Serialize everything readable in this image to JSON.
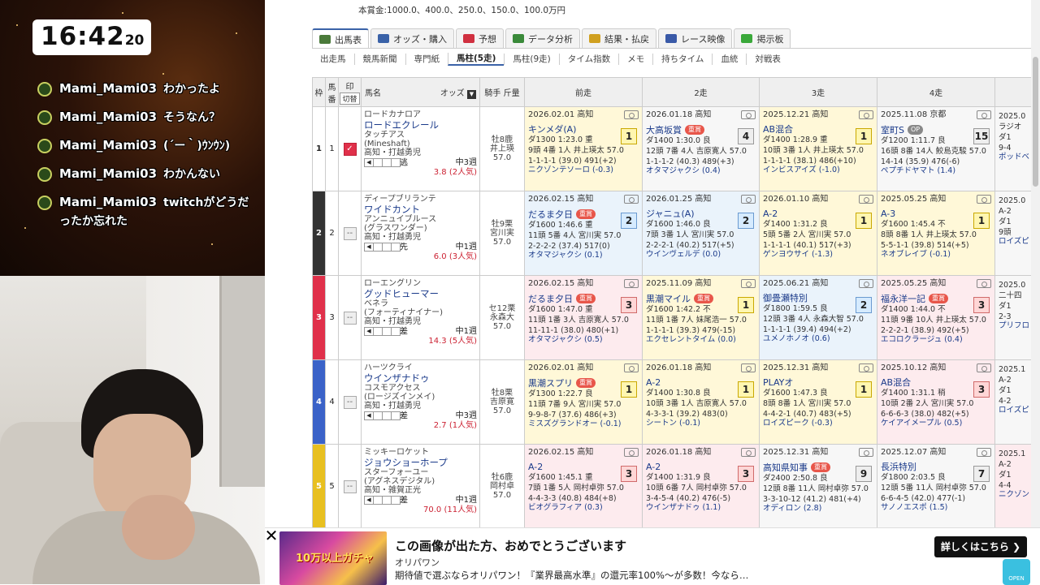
{
  "overlay": {
    "clock": {
      "hm": "16:42",
      "sec": "20"
    },
    "chat": [
      {
        "user": "Mami_Mami03",
        "text": "わかったよ"
      },
      {
        "user": "Mami_Mami03",
        "text": "そうなん？"
      },
      {
        "user": "Mami_Mami03",
        "text": "(´ー｀)ｳﾝｳﾝ)"
      },
      {
        "user": "Mami_Mami03",
        "text": "わかんない"
      },
      {
        "user": "Mami_Mami03",
        "text": "twitchがどうだったか忘れた"
      }
    ]
  },
  "prize_text": "本賞金:1000.0、400.0、250.0、150.0、100.0万円",
  "tabs": [
    {
      "label": "出馬表",
      "icon": "table-icon",
      "color": "#4a7a3a"
    },
    {
      "label": "オッズ・購入",
      "icon": "odds-icon",
      "color": "#3a62a8"
    },
    {
      "label": "予想",
      "icon": "target-icon",
      "color": "#d03040"
    },
    {
      "label": "データ分析",
      "icon": "chart-icon",
      "color": "#3a8a3a"
    },
    {
      "label": "結果・払戻",
      "icon": "coins-icon",
      "color": "#d0a020"
    },
    {
      "label": "レース映像",
      "icon": "video-icon",
      "color": "#3a5aa8"
    },
    {
      "label": "掲示板",
      "icon": "chat-icon",
      "color": "#3aa83a"
    }
  ],
  "subtabs": [
    "出走馬",
    "競馬新聞",
    "専門紙",
    "馬柱(5走)",
    "馬柱(9走)",
    "タイム指数",
    "メモ",
    "持ちタイム",
    "血統",
    "対戦表"
  ],
  "headers": {
    "waku": "枠",
    "umaban": "馬番",
    "mark": "印",
    "mark_btn": "切替",
    "name": "馬名",
    "odds": "オッズ",
    "jockey": "騎手 斤量",
    "r1": "前走",
    "r2": "2走",
    "r3": "3走",
    "r4": "4走"
  },
  "horses": [
    {
      "waku": "1",
      "no": "1",
      "waku_color": "#ffffff",
      "waku_text": "#222222",
      "checked": true,
      "sire": "ロードカナロア",
      "name": "ロードエクレール",
      "dam": "タッチアス",
      "damsire": "(Mineshaft)",
      "trainer": "高知・打越勇児",
      "style": "逃",
      "rest": "中3週",
      "odds": "3.8 (2人気)",
      "sex_age": "牡8鹿",
      "jockey": "井上瑛",
      "weight": "57.0",
      "races": [
        {
          "date": "2026.02.01 高知",
          "name": "キンメダ(A)",
          "grade": "",
          "pos": "1",
          "pc": "pw",
          "bg": "bg1",
          "l1": "ダ1300 1:23.0 重",
          "l2": "9頭 4番 1人 井上瑛太 57.0",
          "l3": "1-1-1-1 (39.0) 491(+2)",
          "op": "ニクゾンテソーロ (-0.3)"
        },
        {
          "date": "2026.01.18 高知",
          "name": "大高坂賞",
          "grade": "重賞",
          "pos": "4",
          "pc": "pg",
          "bg": "bg0",
          "l1": "ダ1400 1:30.0 良",
          "l2": "12頭 7番 4人 吉原寛人 57.0",
          "l3": "1-1-1-2 (40.3) 489(+3)",
          "op": "オタマジャクシ (0.4)"
        },
        {
          "date": "2025.12.21 高知",
          "name": "AB混合",
          "grade": "",
          "pos": "1",
          "pc": "pw",
          "bg": "bg1",
          "l1": "ダ1400 1:28.9 重",
          "l2": "10頭 3番 1人 井上瑛太 57.0",
          "l3": "1-1-1-1 (38.1) 486(+10)",
          "op": "インビスアイズ (-1.0)"
        },
        {
          "date": "2025.11.08 京都",
          "name": "室町S",
          "grade": "OP",
          "pos": "15",
          "pc": "pg",
          "bg": "bg0",
          "l1": "ダ1200 1:11.7 良",
          "l2": "16頭 8番 14人 鮫島克駿 57.0",
          "l3": "14-14 (35.9) 476(-6)",
          "op": "ペプチドヤマト (1.4)"
        }
      ]
    },
    {
      "waku": "2",
      "no": "2",
      "waku_color": "#333333",
      "waku_text": "#ffffff",
      "checked": false,
      "sire": "ディープブリランテ",
      "name": "ワイドカント",
      "dam": "アンニュイブルース",
      "damsire": "(グラスワンダー)",
      "trainer": "高知・打越勇児",
      "style": "先",
      "rest": "中1週",
      "odds": "6.0 (3人気)",
      "sex_age": "牡9栗",
      "jockey": "宮川実",
      "weight": "57.0",
      "races": [
        {
          "date": "2026.02.15 高知",
          "name": "だるま夕日",
          "grade": "重賞",
          "pos": "2",
          "pc": "pb",
          "bg": "bg2",
          "l1": "ダ1600 1:46.6 重",
          "l2": "11頭 5番 4人 宮川実 57.0",
          "l3": "2-2-2-2 (37.4) 517(0)",
          "op": "オタマジャクシ (0.1)"
        },
        {
          "date": "2026.01.25 高知",
          "name": "ジャニュ(A)",
          "grade": "",
          "pos": "2",
          "pc": "pb",
          "bg": "bg2",
          "l1": "ダ1600 1:46.0 良",
          "l2": "7頭 3番 1人 宮川実 57.0",
          "l3": "2-2-2-1 (40.2) 517(+5)",
          "op": "ウインヴェルデ (0.0)"
        },
        {
          "date": "2026.01.10 高知",
          "name": "A-2",
          "grade": "",
          "pos": "1",
          "pc": "pw",
          "bg": "bg1",
          "l1": "ダ1400 1:31.2 良",
          "l2": "5頭 5番 2人 宮川実 57.0",
          "l3": "1-1-1-1 (40.1) 517(+3)",
          "op": "ゲンヨウサイ (-1.3)"
        },
        {
          "date": "2025.05.25 高知",
          "name": "A-3",
          "grade": "",
          "pos": "1",
          "pc": "pw",
          "bg": "bg1",
          "l1": "ダ1600 1:45.4 不",
          "l2": "8頭 8番 1人 井上瑛太 57.0",
          "l3": "5-5-1-1 (39.8) 514(+5)",
          "op": "ネオブレイブ (-0.1)"
        }
      ]
    },
    {
      "waku": "3",
      "no": "3",
      "waku_color": "#e0304a",
      "waku_text": "#ffffff",
      "checked": false,
      "sire": "ローエングリン",
      "name": "グッドヒューマー",
      "dam": "ベネラ",
      "damsire": "(フォーティナイナー)",
      "trainer": "高知・打越勇児",
      "style": "差",
      "rest": "中1週",
      "odds": "14.3 (5人気)",
      "sex_age": "セ12栗",
      "jockey": "永森大",
      "weight": "57.0",
      "races": [
        {
          "date": "2026.02.15 高知",
          "name": "だるま夕日",
          "grade": "重賞",
          "pos": "3",
          "pc": "pr",
          "bg": "bg3",
          "l1": "ダ1600 1:47.0 重",
          "l2": "11頭 1番 3人 吉原寛人 57.0",
          "l3": "11-11-1 (38.0) 480(+1)",
          "op": "オタマジャクシ (0.5)"
        },
        {
          "date": "2025.11.09 高知",
          "name": "黒潮マイル",
          "grade": "重賞",
          "pos": "1",
          "pc": "pw",
          "bg": "bg1",
          "l1": "ダ1600 1:42.2 不",
          "l2": "11頭 1番 7人 妹尾浩一 57.0",
          "l3": "1-1-1-1 (39.3) 479(-15)",
          "op": "エクセレントタイム (0.0)"
        },
        {
          "date": "2025.06.21 高知",
          "name": "御畳瀬特別",
          "grade": "",
          "pos": "2",
          "pc": "pb",
          "bg": "bg2",
          "l1": "ダ1800 1:59.5 良",
          "l2": "12頭 3番 4人 永森大智 57.0",
          "l3": "1-1-1-1 (39.4) 494(+2)",
          "op": "ユメノホノオ (0.6)"
        },
        {
          "date": "2025.05.25 高知",
          "name": "福永洋一記",
          "grade": "重賞",
          "pos": "3",
          "pc": "pr",
          "bg": "bg3",
          "l1": "ダ1400 1:44.0 不",
          "l2": "11頭 9番 10人 井上瑛太 57.0",
          "l3": "2-2-2-1 (38.9) 492(+5)",
          "op": "エコロクラージュ (0.4)"
        }
      ]
    },
    {
      "waku": "4",
      "no": "4",
      "waku_color": "#3a62c8",
      "waku_text": "#ffffff",
      "checked": false,
      "sire": "ハーツクライ",
      "name": "ウインザナドゥ",
      "dam": "コスモアクセス",
      "damsire": "(ロージズインメイ)",
      "trainer": "高知・打越勇児",
      "style": "差",
      "rest": "中3週",
      "odds": "2.7 (1人気)",
      "sex_age": "牡8栗",
      "jockey": "吉原寛",
      "weight": "57.0",
      "races": [
        {
          "date": "2026.02.01 高知",
          "name": "黒潮スプリ",
          "grade": "重賞",
          "pos": "1",
          "pc": "pw",
          "bg": "bg1",
          "l1": "ダ1300 1:22.7 良",
          "l2": "11頭 7番 9人 宮川実 57.0",
          "l3": "9-9-8-7 (37.6) 486(+3)",
          "op": "ミスズグランドオー (-0.1)"
        },
        {
          "date": "2026.01.18 高知",
          "name": "A-2",
          "grade": "",
          "pos": "1",
          "pc": "pw",
          "bg": "bg1",
          "l1": "ダ1400 1:30.8 良",
          "l2": "10頭 3番 1人 吉原寛人 57.0",
          "l3": "4-3-3-1 (39.2) 483(0)",
          "op": "シートン (-0.1)"
        },
        {
          "date": "2025.12.31 高知",
          "name": "PLAYオ",
          "grade": "",
          "pos": "1",
          "pc": "pw",
          "bg": "bg1",
          "l1": "ダ1600 1:47.3 良",
          "l2": "8頭 8番 1人 宮川実 57.0",
          "l3": "4-4-2-1 (40.7) 483(+5)",
          "op": "ロイズピーク (-0.3)"
        },
        {
          "date": "2025.10.12 高知",
          "name": "AB混合",
          "grade": "",
          "pos": "3",
          "pc": "pr",
          "bg": "bg3",
          "l1": "ダ1400 1:31.1 稍",
          "l2": "10頭 2番 2人 宮川実 57.0",
          "l3": "6-6-6-3 (38.0) 482(+5)",
          "op": "ケイアイメープル (0.5)"
        }
      ]
    },
    {
      "waku": "5",
      "no": "5",
      "waku_color": "#e8c020",
      "waku_text": "#ffffff",
      "checked": false,
      "sire": "ミッキーロケット",
      "name": "ジョウショーホープ",
      "dam": "スターフォーユー",
      "damsire": "(アグネスデジタル)",
      "trainer": "高知・雑賀正光",
      "style": "差",
      "rest": "中1週",
      "odds": "70.0 (11人気)",
      "sex_age": "牡6鹿",
      "jockey": "岡村卓",
      "weight": "57.0",
      "races": [
        {
          "date": "2026.02.15 高知",
          "name": "A-2",
          "grade": "",
          "pos": "3",
          "pc": "pr",
          "bg": "bg3",
          "l1": "ダ1600 1:45.1 重",
          "l2": "7頭 1番 5人 岡村卓弥 57.0",
          "l3": "4-4-3-3 (40.8) 484(+8)",
          "op": "ビオグラフィア (0.3)"
        },
        {
          "date": "2026.01.18 高知",
          "name": "A-2",
          "grade": "",
          "pos": "3",
          "pc": "pr",
          "bg": "bg3",
          "l1": "ダ1400 1:31.9 良",
          "l2": "10頭 6番 7人 岡村卓弥 57.0",
          "l3": "3-4-5-4 (40.2) 476(-5)",
          "op": "ウインザナドゥ (1.1)"
        },
        {
          "date": "2025.12.31 高知",
          "name": "高知県知事",
          "grade": "重賞",
          "pos": "9",
          "pc": "pg",
          "bg": "bg0",
          "l1": "ダ2400 2:50.8 良",
          "l2": "12頭 8番 11人 岡村卓弥 57.0",
          "l3": "3-3-10-12 (41.2) 481(+4)",
          "op": "オディロン (2.8)"
        },
        {
          "date": "2025.12.07 高知",
          "name": "長浜特別",
          "grade": "",
          "pos": "7",
          "pc": "pg",
          "bg": "bg0",
          "l1": "ダ1800 2:03.5 良",
          "l2": "12頭 5番 11人 岡村卓弥 57.0",
          "l3": "6-6-4-5 (42.0) 477(-1)",
          "op": "サノノエスポ (1.5)"
        }
      ]
    }
  ],
  "partial_col": [
    {
      "date": "2025.0",
      "l1": "ラジオ",
      "l2": "ダ1",
      "l3": "9-4",
      "op": "ポッドベ"
    },
    {
      "date": "2025.0",
      "l1": "A-2",
      "l2": "ダ1",
      "l3": "9頭",
      "op": "ロイズピ"
    },
    {
      "date": "2025.0",
      "l1": "二十四",
      "l2": "ダ1",
      "l3": "2-3",
      "op": "プリフロ"
    },
    {
      "date": "2025.1",
      "l1": "A-2",
      "l2": "ダ1",
      "l3": "4-2",
      "op": "ロイズピ"
    },
    {
      "date": "2025.1",
      "l1": "A-2",
      "l2": "ダ1",
      "l3": "4-4",
      "op": "ニクゾン"
    }
  ],
  "ad": {
    "image_text": "10万以上ガチャ",
    "title": "この画像が出た方、おめでとうございます",
    "source": "オリパワン",
    "body": "期待値で選ぶならオリパワン！『業界最高水準』の還元率100%〜が多数！今なら…",
    "button": "詳しくはこちら ❯",
    "open": "OPEN"
  }
}
